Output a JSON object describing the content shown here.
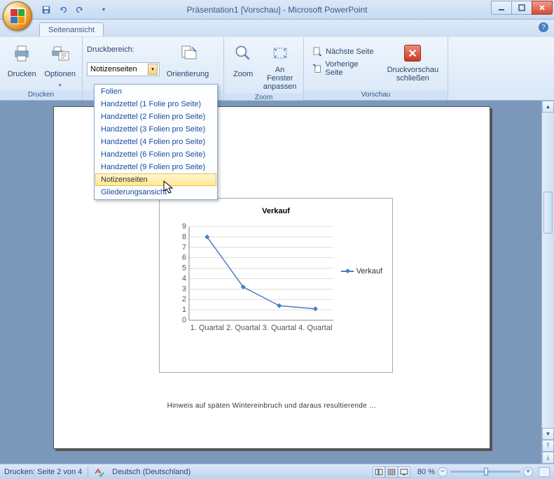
{
  "window": {
    "title": "Präsentation1 [Vorschau] - Microsoft PowerPoint"
  },
  "tabs": {
    "active": "Seitenansicht"
  },
  "ribbon": {
    "groups": {
      "drucken": {
        "label": "Drucken",
        "print": "Drucken",
        "options": "Optionen",
        "range_label": "Druckbereich:",
        "range_value": "Notizenseiten",
        "orientation": "Orientierung"
      },
      "zoom": {
        "label": "Zoom",
        "zoom": "Zoom",
        "fit": "An Fenster anpassen"
      },
      "vorschau": {
        "label": "Vorschau",
        "next": "Nächste Seite",
        "prev": "Vorherige Seite",
        "close": "Druckvorschau schließen"
      }
    }
  },
  "dropdown": {
    "items": [
      "Folien",
      "Handzettel (1 Folie pro Seite)",
      "Handzettel (2 Folien pro Seite)",
      "Handzettel (3 Folien pro Seite)",
      "Handzettel (4 Folien pro Seite)",
      "Handzettel (6 Folien pro Seite)",
      "Handzettel (9 Folien pro Seite)",
      "Notizenseiten",
      "Gliederungsansicht"
    ],
    "selected_index": 7
  },
  "page": {
    "note_text": "Hinweis auf späten Wintereinbruch und daraus resultierende …"
  },
  "chart_data": {
    "type": "line",
    "title": "Verkauf",
    "xlabel": "",
    "ylabel": "",
    "ylim": [
      0,
      9
    ],
    "yticks": [
      0,
      1,
      2,
      3,
      4,
      5,
      6,
      7,
      8,
      9
    ],
    "categories": [
      "1. Quartal",
      "2. Quartal",
      "3. Quartal",
      "4. Quartal"
    ],
    "series": [
      {
        "name": "Verkauf",
        "values": [
          8,
          3.2,
          1.4,
          1.1
        ],
        "color": "#4a7ec2"
      }
    ]
  },
  "status": {
    "page_info": "Drucken: Seite 2 von 4",
    "language": "Deutsch (Deutschland)",
    "zoom_pct": "80 %"
  }
}
